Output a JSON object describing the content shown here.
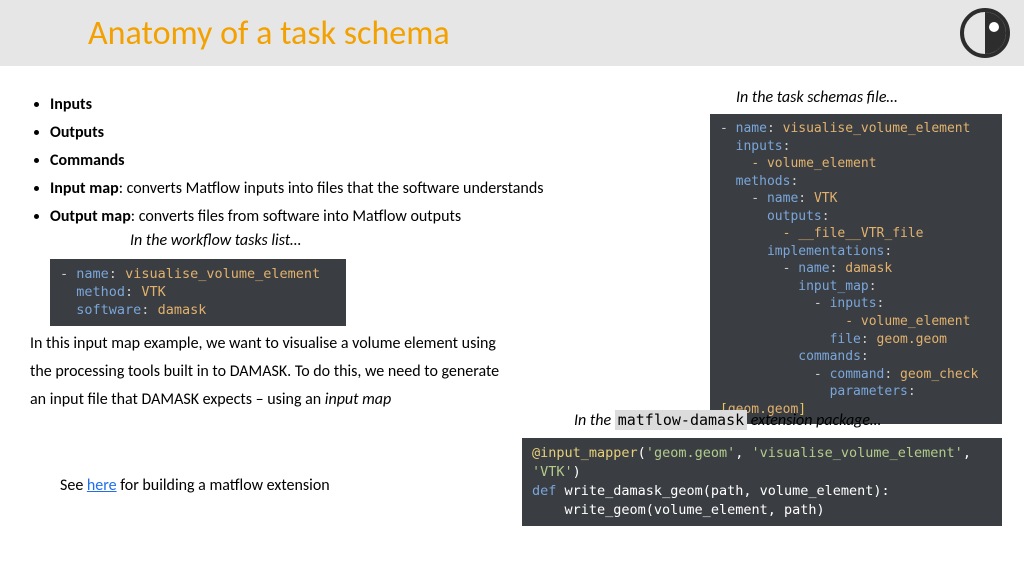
{
  "title": "Anatomy of a task schema",
  "bullets": {
    "b1": "Inputs",
    "b2": "Outputs",
    "b3": "Commands",
    "b4_bold": "Input map",
    "b4_rest": ": converts Matflow inputs into files that the software understands",
    "b5_bold": "Output map",
    "b5_rest": ": converts files from software into Matflow outputs"
  },
  "caption_wf": "In the workflow tasks list…",
  "code1": {
    "l1_key": "name",
    "l1_val": "visualise_volume_element",
    "l2_key": "method",
    "l2_val": "VTK",
    "l3_key": "software",
    "l3_val": "damask"
  },
  "para_text": "In this input map example, we want to visualise a volume element using the processing tools built in to DAMASK. To do this, we need to generate an input file that DAMASK expects – using an ",
  "para_em": "input map",
  "see_pre": "See ",
  "see_link": "here",
  "see_post": " for building a matflow extension",
  "caption_ts": "In the task schemas file…",
  "code2": {
    "l1_key": "name",
    "l1_val": "visualise_volume_element",
    "l2_key": "inputs",
    "l3": "- volume_element",
    "l4_key": "methods",
    "l5_key": "name",
    "l5_val": "VTK",
    "l6_key": "outputs",
    "l7": "- __file__VTR_file",
    "l8_key": "implementations",
    "l9_key": "name",
    "l9_val": "damask",
    "l10_key": "input_map",
    "l11_key": "inputs",
    "l12": "- volume_element",
    "l13_key": "file",
    "l13_val": "geom.geom",
    "l14_key": "commands",
    "l15_key": "command",
    "l15_val": "geom_check",
    "l16_key": "parameters",
    "l16_a": "[",
    "l16_b": "geom.geom",
    "l16_c": "]"
  },
  "caption_ext_pre": "In the ",
  "caption_ext_code": "matflow-damask",
  "caption_ext_post": " extension package…",
  "code3": {
    "dec": "@input_mapper",
    "s1": "'geom.geom'",
    "s2": "'visualise_volume_element'",
    "s3": "'VTK'",
    "def": "def",
    "fn": "write_damask_geom",
    "args": "(path, volume_element):",
    "body": "write_geom(volume_element, path)"
  }
}
